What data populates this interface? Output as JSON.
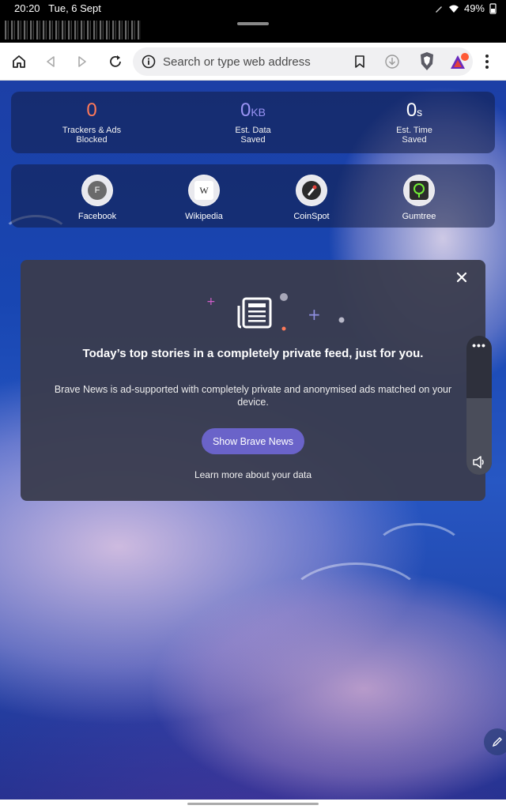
{
  "status_bar": {
    "time": "20:20",
    "date": "Tue, 6 Sept",
    "battery": "49%",
    "icons": [
      "pen-icon",
      "wifi-icon",
      "battery-icon"
    ]
  },
  "toolbar": {
    "search_placeholder": "Search or type web address",
    "icons": [
      "home-icon",
      "back-icon",
      "forward-icon",
      "reload-icon",
      "info-icon",
      "bookmark-icon",
      "download-icon",
      "brave-shields-icon",
      "brave-rewards-icon",
      "overflow-menu-icon"
    ],
    "rewards_badge_color": "#ff5a36"
  },
  "stats": [
    {
      "value": "0",
      "unit": "",
      "label_line1": "Trackers & Ads",
      "label_line2": "Blocked",
      "color": "#ff7a59"
    },
    {
      "value": "0",
      "unit": "KB",
      "label_line1": "Est. Data",
      "label_line2": "Saved",
      "color": "#9a94f5"
    },
    {
      "value": "0",
      "unit": "s",
      "label_line1": "Est. Time",
      "label_line2": "Saved",
      "color": "#ffffff"
    }
  ],
  "top_sites": [
    {
      "name": "Facebook",
      "initial": "F",
      "icon": "facebook-icon"
    },
    {
      "name": "Wikipedia",
      "initial": "W",
      "icon": "wikipedia-icon"
    },
    {
      "name": "CoinSpot",
      "initial": "",
      "icon": "coinspot-icon"
    },
    {
      "name": "Gumtree",
      "initial": "",
      "icon": "gumtree-icon"
    }
  ],
  "news_panel": {
    "headline": "Today’s top stories in a completely private feed, just for you.",
    "body": "Brave News is ad-supported with completely private and anonymised ads matched on your device.",
    "button_label": "Show Brave News",
    "learn_more": "Learn more about your data",
    "accent": "#6a63c9"
  },
  "volume_slider": {
    "menu_glyph": "•••",
    "level_fraction": 0.55
  }
}
